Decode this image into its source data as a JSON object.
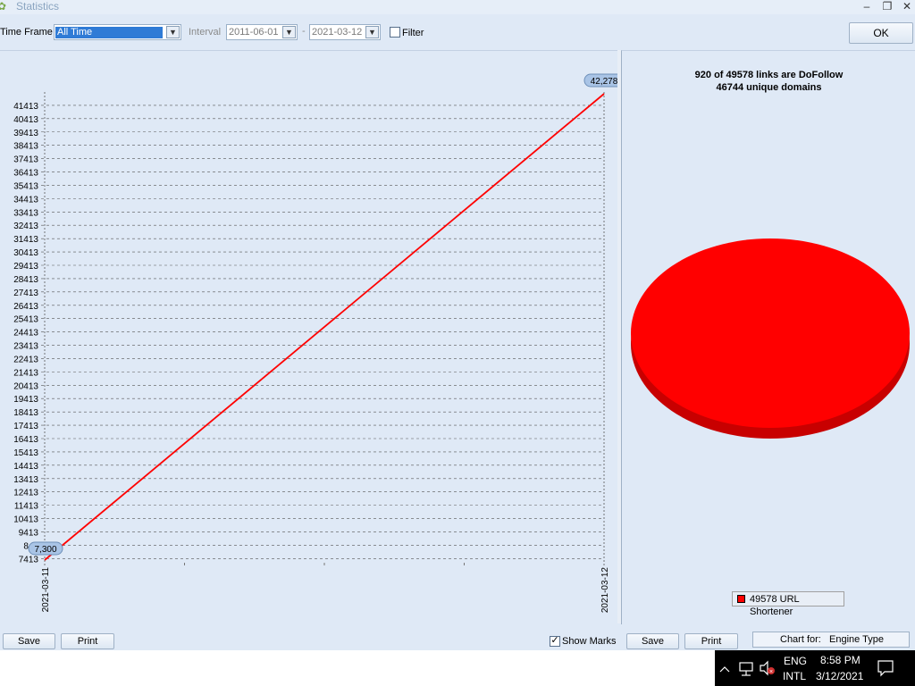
{
  "window": {
    "title": "Statistics",
    "minimize": "–",
    "restore": "❐",
    "close": "✕"
  },
  "toolbar": {
    "time_frame_label": "Time Frame",
    "time_frame_value": "All Time",
    "interval_label": "Interval",
    "interval_from": "2011-06-01",
    "interval_dash": "-",
    "interval_to": "2021-03-12",
    "filter_label": "Filter",
    "filter_checked": false,
    "ok_label": "OK"
  },
  "line_panel": {
    "save_label": "Save",
    "print_label": "Print"
  },
  "pie_panel": {
    "title_line1": "920 of 49578 links are DoFollow",
    "title_line2": "46744 unique domains",
    "show_marks_label": "Show Marks",
    "show_marks_checked": true,
    "save_label": "Save",
    "print_label": "Print",
    "chart_for_label": "Chart for:",
    "chart_for_value": "Engine Type",
    "legend_entry": "49578 URL Shortener"
  },
  "chart_data": [
    {
      "type": "line",
      "x": [
        "2021-03-11",
        "2021-03-12"
      ],
      "series": [
        {
          "values": [
            7300,
            42278
          ],
          "color": "#ff0000"
        }
      ],
      "point_labels": [
        "7,300",
        "42,278"
      ],
      "y_ticks": [
        7413,
        8413,
        9413,
        10413,
        11413,
        12413,
        13413,
        14413,
        15413,
        16413,
        17413,
        18413,
        19413,
        20413,
        21413,
        22413,
        23413,
        24413,
        25413,
        26413,
        27413,
        28413,
        29413,
        30413,
        31413,
        32413,
        33413,
        34413,
        35413,
        36413,
        37413,
        38413,
        39413,
        40413,
        41413
      ],
      "y_tick_labels": [
        "7413",
        "841",
        "9413",
        "10413",
        "11413",
        "12413",
        "13413",
        "14413",
        "15413",
        "16413",
        "17413",
        "18413",
        "19413",
        "20413",
        "21413",
        "22413",
        "23413",
        "24413",
        "25413",
        "26413",
        "27413",
        "28413",
        "29413",
        "30413",
        "31413",
        "32413",
        "33413",
        "34413",
        "35413",
        "36413",
        "37413",
        "38413",
        "39413",
        "40413",
        "41413"
      ],
      "ylim": [
        7300,
        42278
      ],
      "grid": true
    },
    {
      "type": "pie",
      "categories": [
        "URL Shortener"
      ],
      "values": [
        49578
      ],
      "colors": [
        "#ff0000"
      ],
      "legend": "bottom"
    }
  ],
  "taskbar": {
    "lang_line1": "ENG",
    "lang_line2": "INTL",
    "time": "8:58 PM",
    "date": "3/12/2021",
    "chevron_icon": "chevron-up-icon",
    "network_icon": "network-icon",
    "volume_icon": "volume-muted-icon",
    "notification_icon": "notification-icon"
  }
}
